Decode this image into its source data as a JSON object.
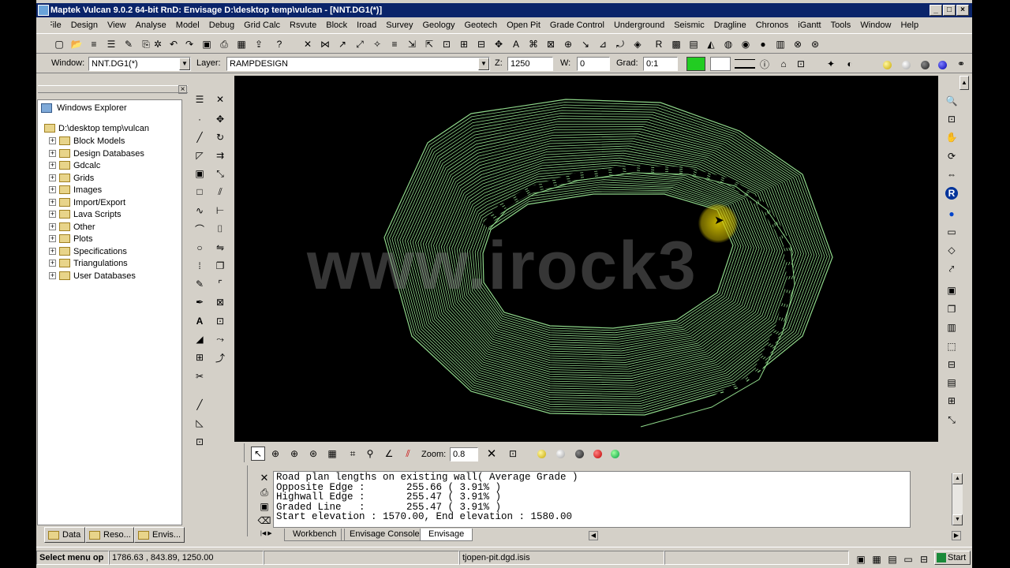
{
  "title": "Maptek Vulcan 9.0.2 64-bit RnD: Envisage  D:\\desktop temp\\vulcan - [NNT.DG1(*)]",
  "menu": [
    "File",
    "Design",
    "View",
    "Analyse",
    "Model",
    "Debug",
    "Grid Calc",
    "Rsvute",
    "Block",
    "Iroad",
    "Survey",
    "Geology",
    "Geotech",
    "Open Pit",
    "Grade Control",
    "Underground",
    "Seismic",
    "Dragline",
    "Chronos",
    "iGantt",
    "Tools",
    "Window",
    "Help"
  ],
  "props": {
    "window_label": "Window:",
    "window_value": "NNT.DG1(*)",
    "layer_label": "Layer:",
    "layer_value": "RAMPDESIGN",
    "z_label": "Z:",
    "z_value": "1250",
    "w_label": "W:",
    "w_value": "0",
    "grad_label": "Grad:",
    "grad_value": "0:1"
  },
  "explorer": {
    "title": "Windows Explorer",
    "root": "D:\\desktop temp\\vulcan",
    "items": [
      "Block Models",
      "Design Databases",
      "Gdcalc",
      "Grids",
      "Images",
      "Import/Export",
      "Lava Scripts",
      "Other",
      "Plots",
      "Specifications",
      "Triangulations",
      "User Databases"
    ]
  },
  "left_tabs": [
    "Data",
    "Reso...",
    "Envis..."
  ],
  "watermark": "www.irock3",
  "zoom": {
    "label": "Zoom:",
    "value": "0.8"
  },
  "console_lines": [
    "Road plan lengths on existing wall( Average Grade )",
    "Opposite Edge :       255.66 ( 3.91% )",
    "Highwall Edge :       255.47 ( 3.91% )",
    "Graded Line   :       255.47 ( 3.91% )",
    "Start elevation : 1570.00, End elevation : 1580.00"
  ],
  "console_tabs": [
    "Workbench",
    "Envisage Console",
    "Envisage"
  ],
  "status": {
    "prompt": "Select menu op",
    "coords": "1786.63 , 843.89, 1250.00",
    "file": "tjopen-pit.dgd.isis",
    "start": "Start"
  },
  "colors": {
    "titlebar": "#0a246a",
    "pit_lines": "#8fd88a",
    "ramp": "#000000",
    "chrome": "#d4d0c8",
    "cursor": "#e8d800"
  }
}
